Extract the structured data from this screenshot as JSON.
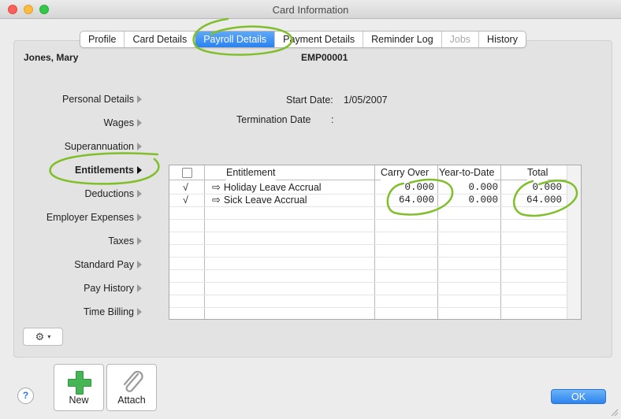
{
  "window": {
    "title": "Card Information"
  },
  "tabs": [
    {
      "label": "Profile",
      "state": "normal"
    },
    {
      "label": "Card Details",
      "state": "normal"
    },
    {
      "label": "Payroll Details",
      "state": "active"
    },
    {
      "label": "Payment Details",
      "state": "normal"
    },
    {
      "label": "Reminder Log",
      "state": "normal"
    },
    {
      "label": "Jobs",
      "state": "disabled"
    },
    {
      "label": "History",
      "state": "normal"
    }
  ],
  "employee": {
    "name": "Jones, Mary",
    "id": "EMP00001"
  },
  "sidenav": {
    "items": [
      "Personal Details",
      "Wages",
      "Superannuation",
      "Entitlements",
      "Deductions",
      "Employer Expenses",
      "Taxes",
      "Standard Pay",
      "Pay History",
      "Time Billing"
    ],
    "active": "Entitlements"
  },
  "fields": {
    "start_date_label": "Start Date:",
    "start_date_value": "1/05/2007",
    "termination_label": "Termination Date",
    "termination_colon": ":"
  },
  "grid": {
    "headers": {
      "entitlement": "Entitlement",
      "carry_over": "Carry Over",
      "ytd": "Year-to-Date",
      "total": "Total"
    },
    "rows": [
      {
        "check": "√",
        "name": "Holiday Leave Accrual",
        "carry_over": "0.000",
        "ytd": "0.000",
        "total": "0.000"
      },
      {
        "check": "√",
        "name": "Sick Leave Accrual",
        "carry_over": "64.000",
        "ytd": "0.000",
        "total": "64.000"
      }
    ]
  },
  "buttons": {
    "new": "New",
    "attach": "Attach",
    "ok": "OK",
    "help": "?"
  },
  "colors": {
    "accent": "#2a82f0",
    "annotation": "#7fbf2a"
  }
}
